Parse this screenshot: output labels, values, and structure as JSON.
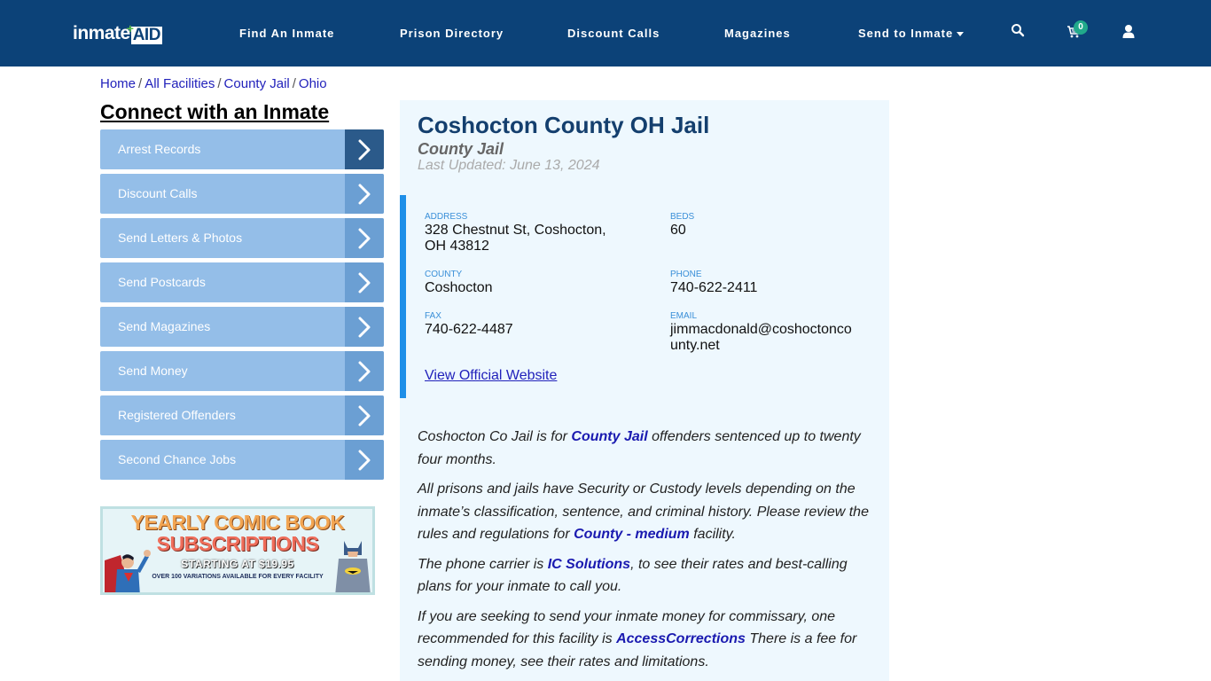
{
  "header": {
    "logo": {
      "text": "inmate",
      "accent": "AID",
      "plus": "+"
    },
    "nav": [
      {
        "label": "Find An Inmate"
      },
      {
        "label": "Prison Directory"
      },
      {
        "label": "Discount Calls"
      },
      {
        "label": "Magazines"
      },
      {
        "label": "Send to Inmate"
      }
    ],
    "icons": {
      "search": "search-icon",
      "cart": "cart-icon",
      "user": "user-icon"
    },
    "cart_count": "0"
  },
  "breadcrumb": [
    {
      "label": "Home"
    },
    {
      "label": "All Facilities"
    },
    {
      "label": "County Jail"
    },
    {
      "label": "Ohio"
    }
  ],
  "breadcrumb_sep": "/",
  "sidebar": {
    "title": "Connect with an Inmate",
    "items": [
      {
        "label": "Arrest Records"
      },
      {
        "label": "Discount Calls"
      },
      {
        "label": "Send Letters & Photos"
      },
      {
        "label": "Send Postcards"
      },
      {
        "label": "Send Magazines"
      },
      {
        "label": "Send Money"
      },
      {
        "label": "Registered Offenders"
      },
      {
        "label": "Second Chance Jobs"
      }
    ],
    "banner": {
      "line1": "YEARLY COMIC BOOK",
      "line2": "SUBSCRIPTIONS",
      "line3": "STARTING AT $19.95",
      "line4": "OVER 100 VARIATIONS AVAILABLE FOR EVERY FACILITY"
    }
  },
  "facility": {
    "title": "Coshocton County OH Jail",
    "type": "County Jail",
    "last_updated": "Last Updated: June 13, 2024",
    "fields": {
      "address": {
        "label": "ADDRESS",
        "value_line1": "328 Chestnut St, Coshocton,",
        "value_line2": "OH 43812"
      },
      "beds": {
        "label": "BEDS",
        "value": "60"
      },
      "county": {
        "label": "COUNTY",
        "value": "Coshocton"
      },
      "phone": {
        "label": "PHONE",
        "value": "740-622-2411"
      },
      "fax": {
        "label": "FAX",
        "value": "740-622-4487"
      },
      "email": {
        "label": "EMAIL",
        "value_line1": "jimmacdonald@coshoctonco",
        "value_line2": "unty.net"
      }
    },
    "website_link": "View Official Website"
  },
  "description": {
    "p1": {
      "before": "Coshocton Co Jail is for ",
      "link": "County Jail",
      "after": " offenders sentenced up to twenty four months."
    },
    "p2": {
      "before": "All prisons and jails have Security or Custody levels depending on the inmate’s classification, sentence, and criminal history. Please review the rules and regulations for ",
      "link": "County - medium",
      "after": " facility."
    },
    "p3": {
      "before": "The phone carrier is ",
      "link": "IC Solutions",
      "after": ", to see their rates and best-calling plans for your inmate to call you."
    },
    "p4": {
      "before": "If you are seeking to send your inmate money for commissary, one recommended for this facility is ",
      "link": "AccessCorrections",
      "after": " There is a fee for sending money, see their rates and limitations."
    }
  }
}
